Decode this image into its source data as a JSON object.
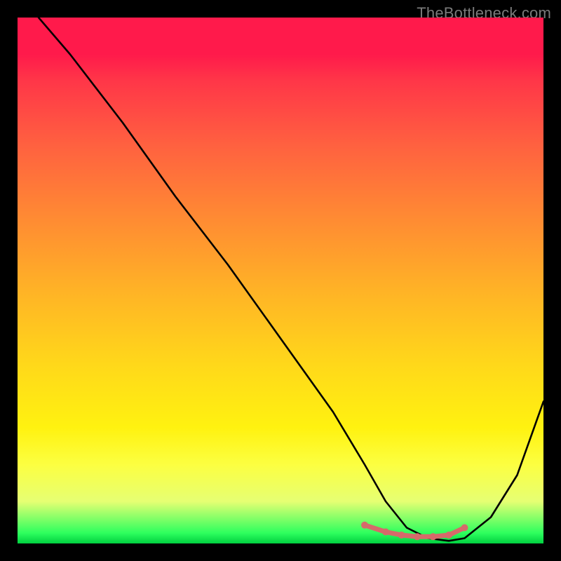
{
  "attribution": "TheBottleneck.com",
  "chart_data": {
    "type": "line",
    "title": "",
    "xlabel": "",
    "ylabel": "",
    "xlim": [
      0,
      100
    ],
    "ylim": [
      0,
      100
    ],
    "series": [
      {
        "name": "bottleneck-curve",
        "x": [
          4,
          10,
          20,
          30,
          40,
          50,
          60,
          66,
          70,
          74,
          78,
          82,
          85,
          90,
          95,
          100
        ],
        "y": [
          100,
          93,
          80,
          66,
          53,
          39,
          25,
          15,
          8,
          3,
          1,
          0.5,
          1,
          5,
          13,
          27
        ]
      }
    ],
    "highlight_segment": {
      "name": "flat-min-highlight",
      "x": [
        66,
        70,
        73,
        76,
        79,
        82,
        85
      ],
      "y": [
        3.5,
        2.2,
        1.6,
        1.3,
        1.3,
        1.6,
        3.0
      ]
    },
    "gradient_stops": [
      {
        "pos": 0,
        "color": "#ff1a4b"
      },
      {
        "pos": 7,
        "color": "#ff1a4b"
      },
      {
        "pos": 12,
        "color": "#ff3648"
      },
      {
        "pos": 24,
        "color": "#ff6040"
      },
      {
        "pos": 38,
        "color": "#ff8a33"
      },
      {
        "pos": 52,
        "color": "#ffb326"
      },
      {
        "pos": 66,
        "color": "#ffd81a"
      },
      {
        "pos": 78,
        "color": "#fff210"
      },
      {
        "pos": 85,
        "color": "#fcff41"
      },
      {
        "pos": 92,
        "color": "#e6ff73"
      },
      {
        "pos": 98,
        "color": "#2eff5e"
      },
      {
        "pos": 100,
        "color": "#00d040"
      }
    ],
    "colors": {
      "curve": "#000000",
      "highlight": "#d66a6a"
    }
  }
}
